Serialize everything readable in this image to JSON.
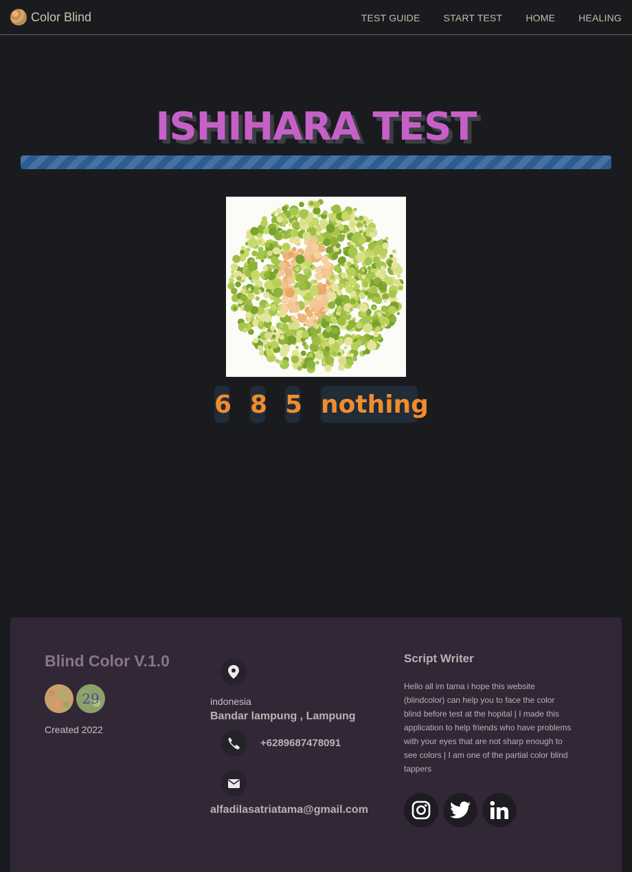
{
  "navbar": {
    "brand": "Color Blind",
    "links": [
      "TEST GUIDE",
      "START TEST",
      "HOME",
      "HEALING"
    ]
  },
  "main": {
    "title": "ISHIHARA TEST",
    "progress_fraction": 1.0,
    "answers": [
      "6",
      "8",
      "5",
      "nothing"
    ]
  },
  "footer": {
    "title": "Blind Color V.1.0",
    "plate_logo_number": "29",
    "created": "Created 2022",
    "country": "indonesia",
    "city": "Bandar lampung , Lampung",
    "phone": "+6289687478091",
    "email": "alfadilasatriatama@gmail.com",
    "script_writer_title": "Script Writer",
    "script_writer_text": "Hello all im tama i hope this website (blindcolor) can help you to face the color blind before test at the hopital | I made this application to help friends who have problems with your eyes that are not sharp enough to see colors | I am one of the partial color blind tappers",
    "socials": [
      "instagram-icon",
      "twitter-icon",
      "linkedin-icon"
    ]
  },
  "colors": {
    "title": "#c660c8",
    "answer_text": "#f08c2d",
    "progress": "#2b5c93",
    "footer_bg": "#322736"
  }
}
